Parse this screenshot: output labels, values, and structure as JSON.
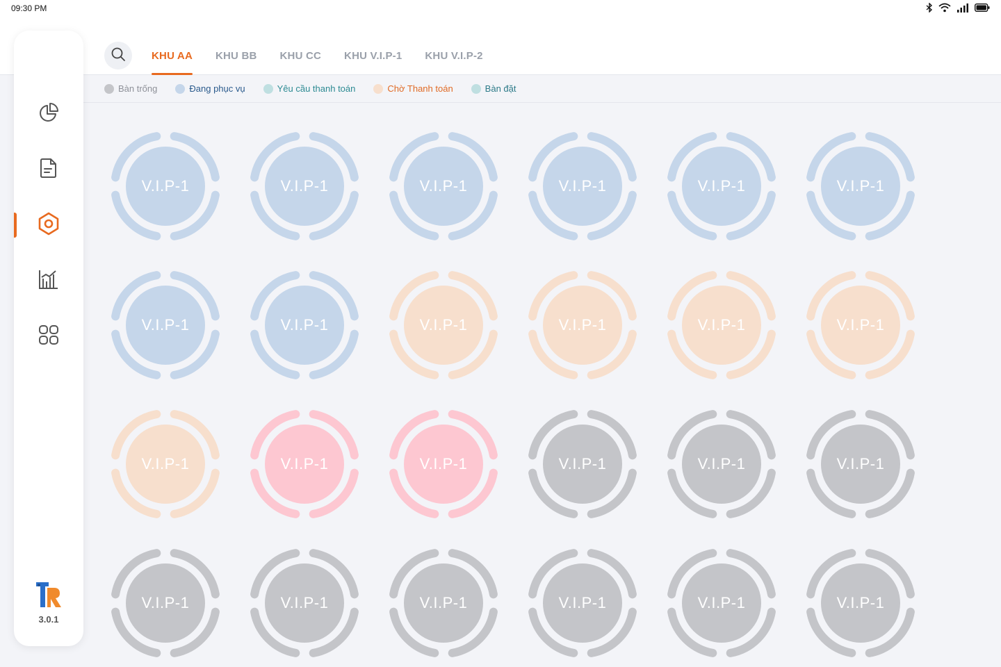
{
  "status_bar": {
    "time": "09:30 PM"
  },
  "tabs": [
    {
      "label": "KHU AA",
      "active": true
    },
    {
      "label": "KHU BB",
      "active": false
    },
    {
      "label": "KHU CC",
      "active": false
    },
    {
      "label": "KHU V.I.P-1",
      "active": false
    },
    {
      "label": "KHU V.I.P-2",
      "active": false
    }
  ],
  "legend": [
    {
      "label": "Bàn trống",
      "dot_color": "#c4c5c9",
      "text_color": "#8e9199"
    },
    {
      "label": "Đang phục vụ",
      "dot_color": "#c5d6ea",
      "text_color": "#2a5a8c"
    },
    {
      "label": "Yêu cầu thanh toán",
      "dot_color": "#bfdfe1",
      "text_color": "#2c8a92"
    },
    {
      "label": "Chờ Thanh toán",
      "dot_color": "#f7dfcd",
      "text_color": "#e06a25"
    },
    {
      "label": "Bàn đặt",
      "dot_color": "#bfdfe1",
      "text_color": "#2c7a88"
    }
  ],
  "sidebar": {
    "items": [
      {
        "name": "dashboard",
        "icon": "pie-chart-icon",
        "active": false
      },
      {
        "name": "orders",
        "icon": "document-icon",
        "active": false
      },
      {
        "name": "tables",
        "icon": "location-pin-icon",
        "active": true
      },
      {
        "name": "reports",
        "icon": "bar-chart-icon",
        "active": false
      },
      {
        "name": "menu",
        "icon": "grid-icon",
        "active": false
      }
    ],
    "version": "3.0.1"
  },
  "colors": {
    "accent": "#e86a1f",
    "serving": "#c5d6ea",
    "waiting_payment": "#f7dfcd",
    "reserved_pink": "#fdc7d1",
    "empty": "#c4c5c9"
  },
  "tables": [
    {
      "label": "V.I.P-1",
      "status": "serving"
    },
    {
      "label": "V.I.P-1",
      "status": "serving"
    },
    {
      "label": "V.I.P-1",
      "status": "serving"
    },
    {
      "label": "V.I.P-1",
      "status": "serving"
    },
    {
      "label": "V.I.P-1",
      "status": "serving"
    },
    {
      "label": "V.I.P-1",
      "status": "serving"
    },
    {
      "label": "V.I.P-1",
      "status": "serving"
    },
    {
      "label": "V.I.P-1",
      "status": "serving"
    },
    {
      "label": "V.I.P-1",
      "status": "waiting_payment"
    },
    {
      "label": "V.I.P-1",
      "status": "waiting_payment"
    },
    {
      "label": "V.I.P-1",
      "status": "waiting_payment"
    },
    {
      "label": "V.I.P-1",
      "status": "waiting_payment"
    },
    {
      "label": "V.I.P-1",
      "status": "waiting_payment"
    },
    {
      "label": "V.I.P-1",
      "status": "reserved_pink"
    },
    {
      "label": "V.I.P-1",
      "status": "reserved_pink"
    },
    {
      "label": "V.I.P-1",
      "status": "empty"
    },
    {
      "label": "V.I.P-1",
      "status": "empty"
    },
    {
      "label": "V.I.P-1",
      "status": "empty"
    },
    {
      "label": "V.I.P-1",
      "status": "empty"
    },
    {
      "label": "V.I.P-1",
      "status": "empty"
    },
    {
      "label": "V.I.P-1",
      "status": "empty"
    },
    {
      "label": "V.I.P-1",
      "status": "empty"
    },
    {
      "label": "V.I.P-1",
      "status": "empty"
    },
    {
      "label": "V.I.P-1",
      "status": "empty"
    }
  ]
}
